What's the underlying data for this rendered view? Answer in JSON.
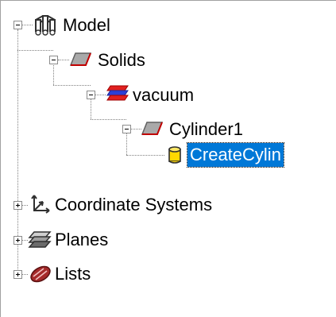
{
  "tree": {
    "nodes": [
      {
        "label": "Model",
        "expanded": true,
        "icon": "model-icon"
      },
      {
        "label": "Solids",
        "expanded": true,
        "icon": "solid-parallelogram-icon"
      },
      {
        "label": "vacuum",
        "expanded": true,
        "icon": "material-layers-icon"
      },
      {
        "label": "Cylinder1",
        "expanded": true,
        "icon": "solid-parallelogram-icon"
      },
      {
        "label": "CreateCylin",
        "selected": true,
        "icon": "cylinder-icon"
      },
      {
        "label": "Coordinate Systems",
        "expanded": false,
        "icon": "coordinate-axes-icon"
      },
      {
        "label": "Planes",
        "expanded": false,
        "icon": "planes-icon"
      },
      {
        "label": "Lists",
        "expanded": false,
        "icon": "lists-icon"
      }
    ]
  },
  "colors": {
    "selection": "#0078d7",
    "selection_text": "#ffffff",
    "tree_line": "#808080",
    "solid_icon_fill": "#a9a9a9",
    "solid_icon_edge": "#c00000",
    "cylinder_icon": "#ffd800",
    "lists_icon": "#a52a2a"
  }
}
